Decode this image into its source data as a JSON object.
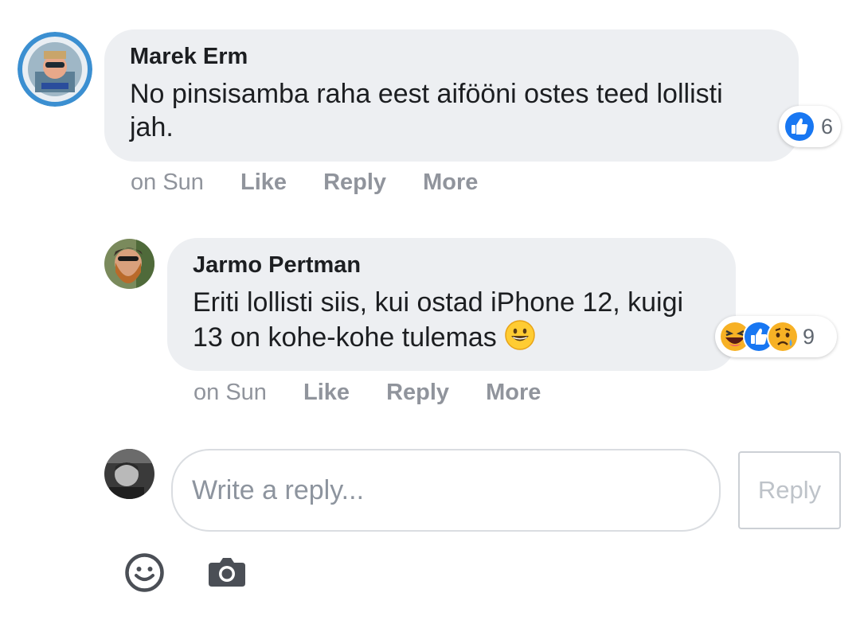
{
  "comments": [
    {
      "author": "Marek Erm",
      "text": "No pinsisamba raha eest aifööni ostes teed lollisti jah.",
      "reaction_count": "6",
      "reactions": [
        "like-icon"
      ],
      "timestamp": "on Sun",
      "actions": {
        "like": "Like",
        "reply": "Reply",
        "more": "More"
      }
    },
    {
      "author": "Jarmo Pertman",
      "text": "Eriti lollisti siis, kui ostad iPhone 12, kuigi 13 on kohe-kohe tulemas",
      "text_emoji": "grinning-face-emoji",
      "reaction_count": "9",
      "reactions": [
        "haha-icon",
        "like-icon",
        "sad-icon"
      ],
      "timestamp": "on Sun",
      "actions": {
        "like": "Like",
        "reply": "Reply",
        "more": "More"
      }
    }
  ],
  "reply_box": {
    "placeholder": "Write a reply...",
    "value": "",
    "submit_label": "Reply"
  },
  "toolbar": {
    "icons": [
      "emoji-icon",
      "camera-icon"
    ]
  },
  "colors": {
    "bubble": "#edeff2",
    "like_blue": "#1877f2",
    "muted_text": "#90949c",
    "haha_yellow": "#f7b125"
  }
}
